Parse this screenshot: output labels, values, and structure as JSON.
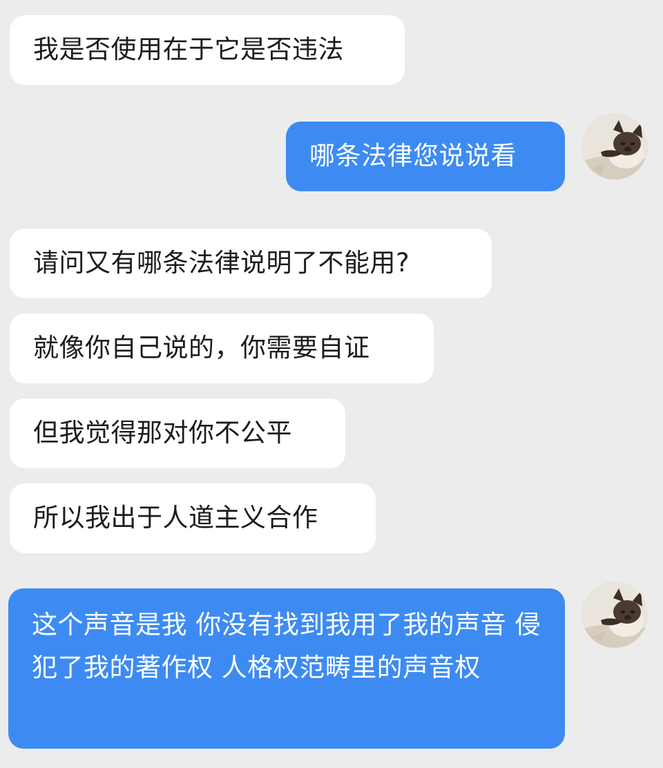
{
  "messages": [
    {
      "side": "in",
      "text": "我是否使用在于它是否违法"
    },
    {
      "side": "out",
      "text": "哪条法律您说说看"
    },
    {
      "side": "in",
      "text": "请问又有哪条法律说明了不能用?"
    },
    {
      "side": "in",
      "text": "就像你自己说的，你需要自证"
    },
    {
      "side": "in",
      "text": "但我觉得那对你不公平"
    },
    {
      "side": "in",
      "text": "所以我出于人道主义合作"
    },
    {
      "side": "out",
      "text": "这个声音是我 你没有找到我用了我的声音 侵犯了我的著作权 人格权范畴里的声音权"
    }
  ],
  "avatar": {
    "icon": "siamese-cat-avatar-icon"
  },
  "colors": {
    "background": "#ececec",
    "incoming_bubble": "#ffffff",
    "outgoing_bubble": "#3d8bf2",
    "outgoing_text": "#ffffff",
    "incoming_text": "#1c1c1c"
  }
}
